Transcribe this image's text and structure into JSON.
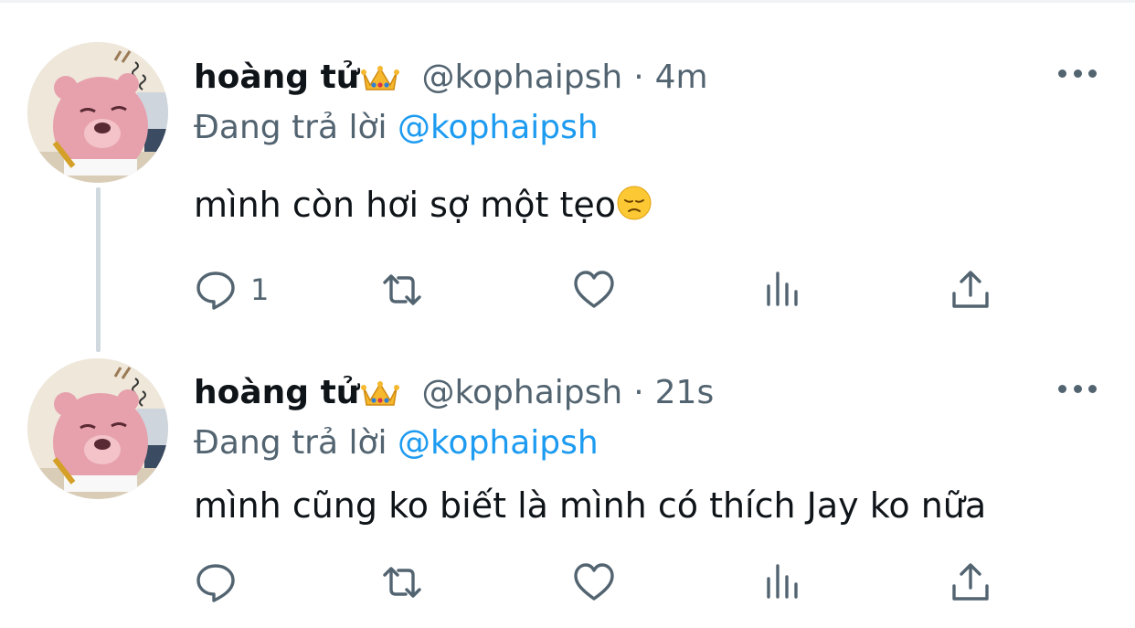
{
  "tweets": [
    {
      "display_name": "hoàng tử",
      "name_emoji": "crown-emoji",
      "handle": "@kophaipsh",
      "separator": "·",
      "time": "4m",
      "reply_prefix": "Đang trả lời",
      "reply_to": "@kophaipsh",
      "text": "mình còn hơi sợ một tẹo",
      "text_emoji": "pensive-face-emoji",
      "reply_count": "1"
    },
    {
      "display_name": "hoàng tử",
      "name_emoji": "crown-emoji",
      "handle": "@kophaipsh",
      "separator": "·",
      "time": "21s",
      "reply_prefix": "Đang trả lời",
      "reply_to": "@kophaipsh",
      "text": "mình cũng ko biết là mình có thích Jay ko nữa",
      "reply_count": ""
    }
  ],
  "icons": [
    "more-icon",
    "reply-icon",
    "retweet-icon",
    "like-icon",
    "views-icon",
    "share-icon"
  ],
  "colors": {
    "text_primary": "#0f1419",
    "text_secondary": "#536471",
    "link": "#1d9bf0",
    "thread_line": "#cfd9de"
  }
}
